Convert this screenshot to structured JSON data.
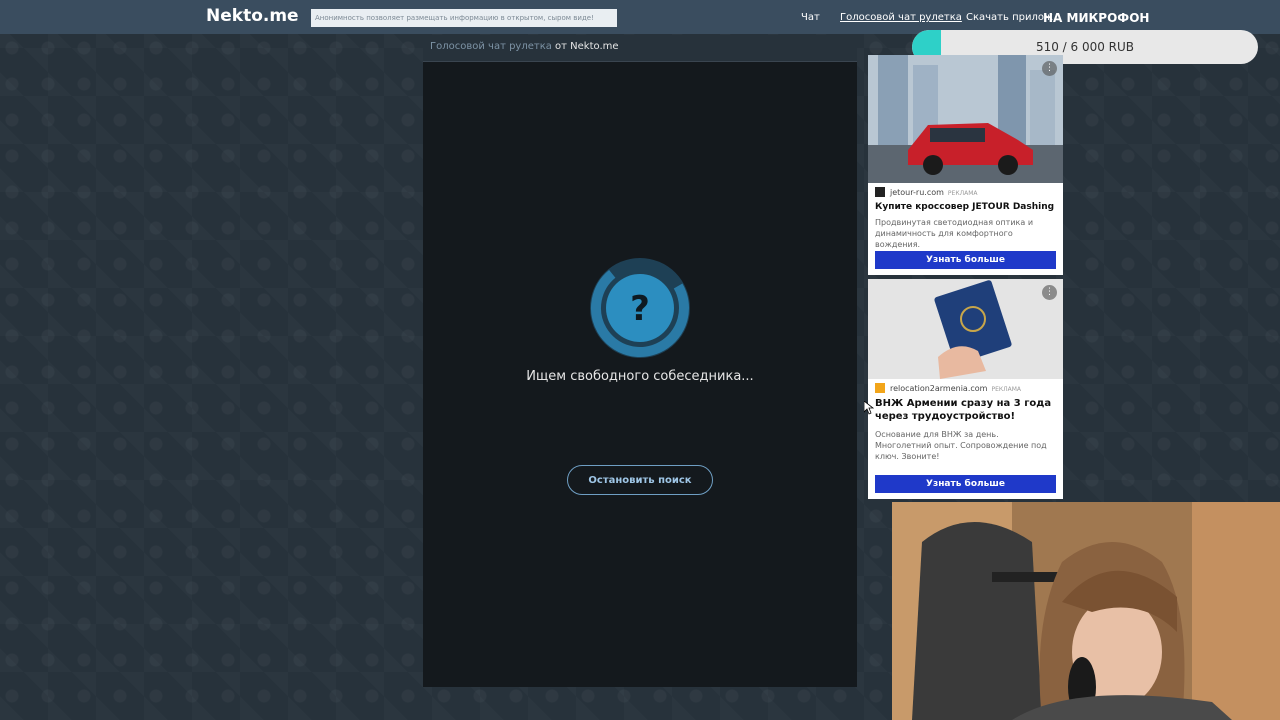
{
  "header": {
    "logo": "Nekto.me",
    "notice": "Анонимность позволяет размещать информацию в открытом, сыром виде!",
    "nav": [
      {
        "label": "Чат"
      },
      {
        "label": "Голосовой чат рулетка"
      },
      {
        "label": "Скачать прилож"
      }
    ]
  },
  "stream_overlay": {
    "mic_title": "НА МИКРОФОН",
    "donation_text": "510 / 6 000 RUB",
    "donation_progress": 0.085
  },
  "chat": {
    "breadcrumb_link": "Голосовой чат рулетка",
    "breadcrumb_rest": " от Nekto.me",
    "status_icon": "?",
    "status_text": "Ищем свободного собеседника...",
    "stop_button": "Остановить поиск"
  },
  "ads": [
    {
      "domain": "jetour-ru.com",
      "tag": "РЕКЛАМА",
      "title": "Купите кроссовер JETOUR Dashing",
      "body": "Продвинутая светодиодная оптика и динамичность для комфортного вождения.",
      "button": "Узнать больше",
      "image": "red-suv-car"
    },
    {
      "domain": "relocation2armenia.com",
      "tag": "РЕКЛАМА",
      "title": "ВНЖ Армении сразу на 3 года через трудоустройство!",
      "body": "Основание для ВНЖ за день. Многолетний опыт. Сопровождение под ключ. Звоните!",
      "button": "Узнать больше",
      "image": "hand-holding-passport"
    }
  ],
  "colors": {
    "topbar": "#3a4d5f",
    "panel": "#14191d",
    "accent": "#2f8fc1",
    "ad_button": "#1f39c9",
    "donation_fill": "#2ed0c8"
  }
}
